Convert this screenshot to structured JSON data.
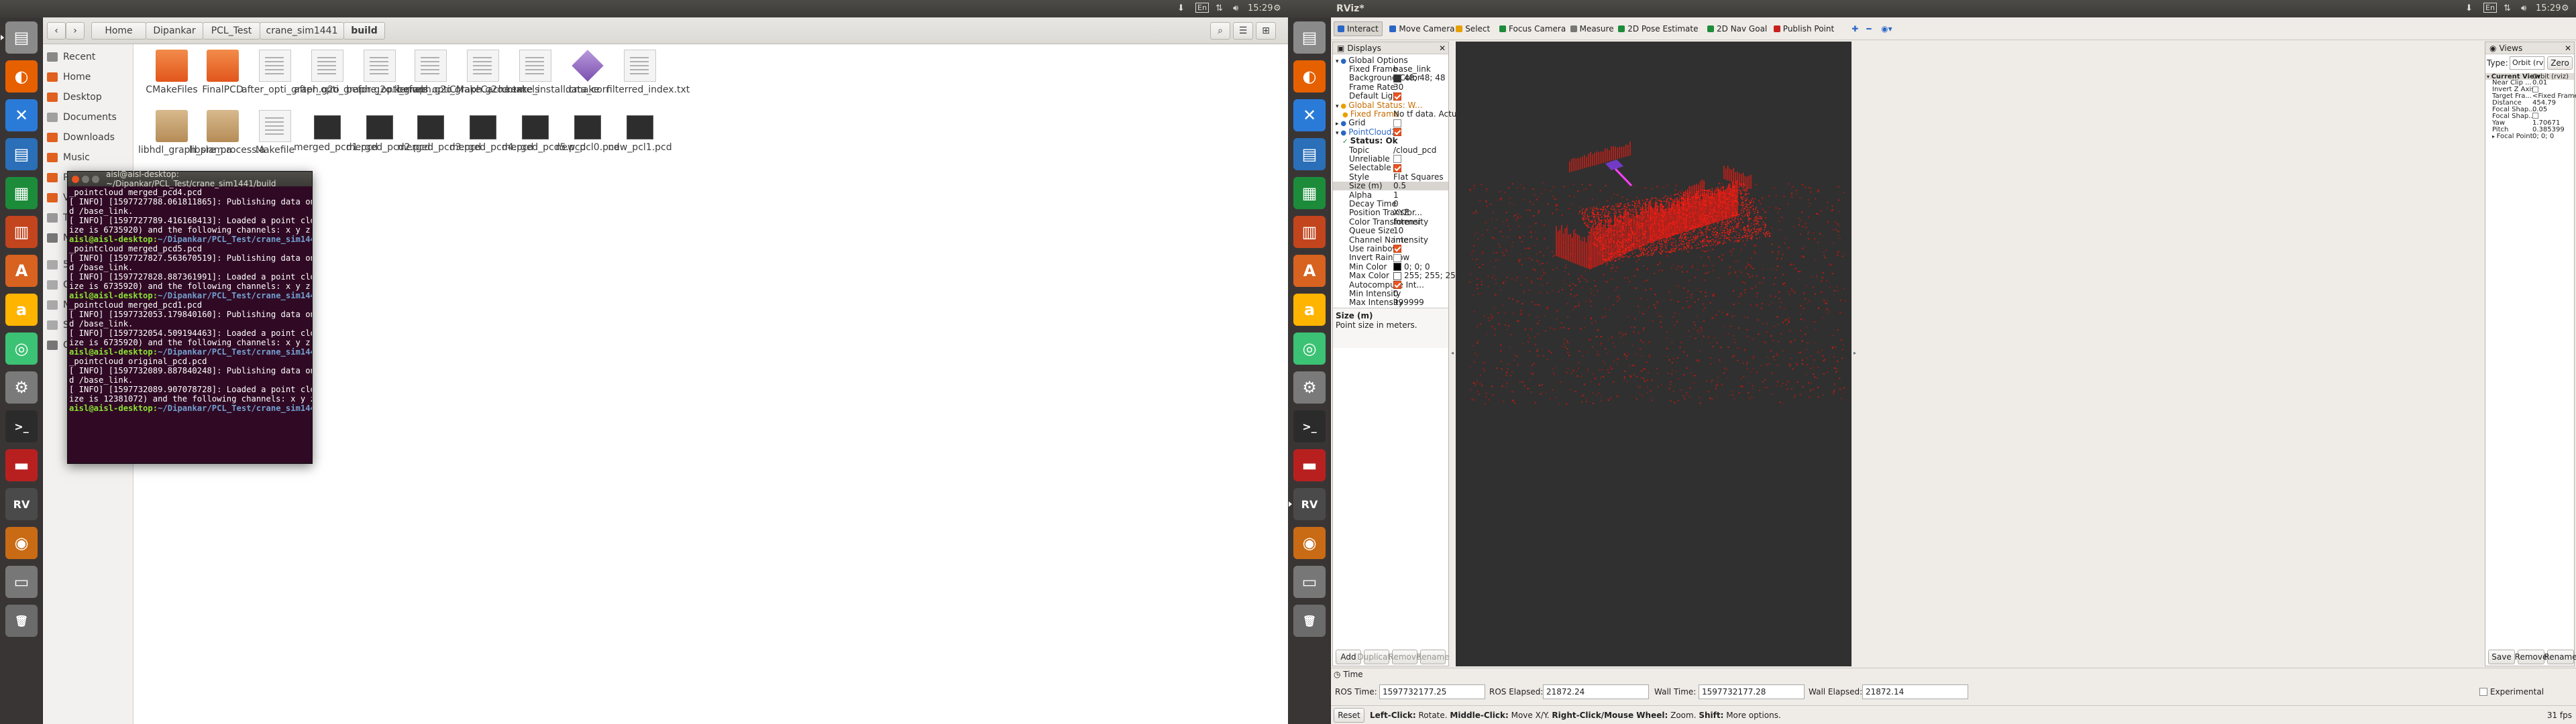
{
  "left": {
    "topbar": {
      "time": "15:29"
    },
    "launcher": [
      "Files",
      "Firefox",
      "VS Code",
      "Writer",
      "Calc",
      "Impress",
      "Software",
      "Amazon",
      "Atom",
      "Settings",
      "Terminal",
      "System Monitor",
      "RViz",
      "Photos",
      "Drive",
      "Trash"
    ],
    "files": {
      "breadcrumb": [
        "Home",
        "Dipankar",
        "PCL_Test",
        "crane_sim1441",
        "build"
      ],
      "sidebar": [
        "Recent",
        "Home",
        "Desktop",
        "Documents",
        "Downloads",
        "Music",
        "Pictures",
        "Videos",
        "Trash",
        "Network",
        "587 GB Volume",
        "Computer",
        "New Volume",
        "SAMSUNG Android",
        "Connect to Server"
      ],
      "items": [
        {
          "name": "CMakeFiles",
          "type": "folder"
        },
        {
          "name": "FinalPCD",
          "type": "folder"
        },
        {
          "name": "after_opti_graph.g2o",
          "type": "doc"
        },
        {
          "name": "after_opti_graph.g2o.kernels",
          "type": "doc"
        },
        {
          "name": "before_opti_graph.g2o",
          "type": "doc"
        },
        {
          "name": "before_opti_graph.g2o.kernels",
          "type": "doc"
        },
        {
          "name": "CMakeCache.txt",
          "type": "doc"
        },
        {
          "name": "cmake_install.cmake",
          "type": "doc"
        },
        {
          "name": "data_corr",
          "type": "dia"
        },
        {
          "name": "filterred_index.txt",
          "type": "doc"
        },
        {
          "name": "libhdl_graph_slam.a",
          "type": "arch"
        },
        {
          "name": "libpre_process.a",
          "type": "arch"
        },
        {
          "name": "Makefile",
          "type": "doc"
        },
        {
          "name": "merged_pcd1.pcd",
          "type": "pcd"
        },
        {
          "name": "merged_pcd2.pcd",
          "type": "pcd"
        },
        {
          "name": "merged_pcd3.pcd",
          "type": "pcd"
        },
        {
          "name": "merged_pcd4.pcd",
          "type": "pcd"
        },
        {
          "name": "merged_pcd5.pcd",
          "type": "pcd"
        },
        {
          "name": "new_pcl0.pcd",
          "type": "pcd"
        },
        {
          "name": "new_pcl1.pcd",
          "type": "pcd"
        }
      ]
    },
    "terminal": {
      "title": "aisl@aisl-desktop: ~/Dipankar/PCL_Test/crane_sim1441/build",
      "lines": [
        [
          "t",
          "_pointcloud merged_pcd4.pcd"
        ],
        [
          "t",
          "[ INFO] [1597727788.061811865]: Publishing data on topic /cloud_pcd with frame_i"
        ],
        [
          "t",
          "d /base_link."
        ],
        [
          "t",
          "[ INFO] [1597727789.416168413]: Loaded a point cloud with 420995 points (total s"
        ],
        [
          "t",
          "ize is 6735920) and the following channels: x y z intensity."
        ],
        [
          "p",
          "aisl@aisl-desktop",
          "~/Dipankar/PCL_Test/crane_sim1441/build",
          "$ rosrun pcl_ros pcd_to"
        ],
        [
          "t",
          "_pointcloud merged_pcd5.pcd"
        ],
        [
          "t",
          "[ INFO] [1597727827.563670519]: Publishing data on topic /cloud_pcd with frame_i"
        ],
        [
          "t",
          "d /base_link."
        ],
        [
          "t",
          "[ INFO] [1597727828.887361991]: Loaded a point cloud with 420995 points (total s"
        ],
        [
          "t",
          "ize is 6735920) and the following channels: x y z intensity."
        ],
        [
          "p",
          "aisl@aisl-desktop",
          "~/Dipankar/PCL_Test/crane_sim1441/build",
          "$ rosrun pcl_ros pcd_to"
        ],
        [
          "t",
          "_pointcloud merged_pcd1.pcd"
        ],
        [
          "t",
          "[ INFO] [1597732053.179840160]: Publishing data on topic /cloud_pcd with frame_i"
        ],
        [
          "t",
          "d /base_link."
        ],
        [
          "t",
          "[ INFO] [1597732054.509194463]: Loaded a point cloud with 420995 points (total s"
        ],
        [
          "t",
          "ize is 6735920) and the following channels: x y z intensity."
        ],
        [
          "p",
          "aisl@aisl-desktop",
          "~/Dipankar/PCL_Test/crane_sim1441/build",
          "$ rosrun pcl_ros pcd_to"
        ],
        [
          "t",
          "_pointcloud original_pcd.pcd"
        ],
        [
          "t",
          "[ INFO] [1597732089.887840248]: Publishing data on topic /cloud_pcd with frame_i"
        ],
        [
          "t",
          "d /base_link."
        ],
        [
          "t",
          "[ INFO] [1597732089.907078728]: Loaded a point cloud with 773817 points (total s"
        ],
        [
          "t",
          "ize is 12381072) and the following channels: x y z intensity."
        ],
        [
          "p",
          "aisl@aisl-desktop",
          "~/Dipankar/PCL_Test/crane_sim1441/build",
          "$ "
        ]
      ]
    }
  },
  "right": {
    "topbar": {
      "app": "RViz*",
      "time": "15:29"
    },
    "toolbar": [
      "Interact",
      "Move Camera",
      "Select",
      "Focus Camera",
      "Measure",
      "2D Pose Estimate",
      "2D Nav Goal",
      "Publish Point"
    ],
    "displays": {
      "title": "Displays",
      "rows": [
        {
          "k": "Global Options",
          "v": "",
          "lvl": 0,
          "h": true
        },
        {
          "k": "Fixed Frame",
          "v": "base_link",
          "lvl": 2
        },
        {
          "k": "Background Color",
          "v": "48; 48; 48",
          "lvl": 2,
          "sw": "#303030"
        },
        {
          "k": "Frame Rate",
          "v": "30",
          "lvl": 2
        },
        {
          "k": "Default Light",
          "v": "",
          "lvl": 2,
          "cb": true
        },
        {
          "k": "Global Status: W...",
          "v": "",
          "lvl": 0,
          "warn": true,
          "h": true
        },
        {
          "k": "Fixed Frame",
          "v": "No tf data.  Actual erro...",
          "lvl": 1,
          "warn": true
        },
        {
          "k": "Grid",
          "v": "",
          "lvl": 0,
          "h": true,
          "cb": false
        },
        {
          "k": "PointCloud2",
          "v": "",
          "lvl": 0,
          "h": true,
          "cb": true,
          "blue": true
        },
        {
          "k": "Status: Ok",
          "v": "",
          "lvl": 1,
          "ok": true
        },
        {
          "k": "Topic",
          "v": "/cloud_pcd",
          "lvl": 2
        },
        {
          "k": "Unreliable",
          "v": "",
          "lvl": 2,
          "cb": false
        },
        {
          "k": "Selectable",
          "v": "",
          "lvl": 2,
          "cb": true
        },
        {
          "k": "Style",
          "v": "Flat Squares",
          "lvl": 2
        },
        {
          "k": "Size (m)",
          "v": "0.5",
          "lvl": 2,
          "sel": true
        },
        {
          "k": "Alpha",
          "v": "1",
          "lvl": 2
        },
        {
          "k": "Decay Time",
          "v": "0",
          "lvl": 2
        },
        {
          "k": "Position Transfor...",
          "v": "XYZ",
          "lvl": 2
        },
        {
          "k": "Color Transformer",
          "v": "Intensity",
          "lvl": 2
        },
        {
          "k": "Queue Size",
          "v": "10",
          "lvl": 2
        },
        {
          "k": "Channel Name",
          "v": "intensity",
          "lvl": 2
        },
        {
          "k": "Use rainbow",
          "v": "",
          "lvl": 2,
          "cb": true
        },
        {
          "k": "Invert Rainbow",
          "v": "",
          "lvl": 2,
          "cb": false
        },
        {
          "k": "Min Color",
          "v": "0; 0; 0",
          "lvl": 2,
          "sw": "#000000"
        },
        {
          "k": "Max Color",
          "v": "255; 255; 255",
          "lvl": 2,
          "sw": "#ffffff"
        },
        {
          "k": "Autocompute Int...",
          "v": "",
          "lvl": 2,
          "cb": true
        },
        {
          "k": "Min Intensity",
          "v": "0",
          "lvl": 2
        },
        {
          "k": "Max Intensity",
          "v": "999999",
          "lvl": 2
        }
      ],
      "desc_title": "Size (m)",
      "desc": "Point size in meters.",
      "buttons": [
        "Add",
        "Duplicate",
        "Remove",
        "Rename"
      ]
    },
    "views": {
      "title": "Views",
      "type_label": "Type:",
      "type_value": "Orbit (rviz)",
      "zero": "Zero",
      "rows": [
        {
          "k": "Current View",
          "v": "Orbit (rviz)",
          "h": true
        },
        {
          "k": "Near Clip ...",
          "v": "0.01"
        },
        {
          "k": "Invert Z Axis",
          "v": "",
          "cb": false
        },
        {
          "k": "Target Fra...",
          "v": "<Fixed Frame>"
        },
        {
          "k": "Distance",
          "v": "454.79"
        },
        {
          "k": "Focal Shap...",
          "v": "0.05"
        },
        {
          "k": "Focal Shap...",
          "v": "",
          "cb": false
        },
        {
          "k": "Yaw",
          "v": "1.70671"
        },
        {
          "k": "Pitch",
          "v": "0.385399"
        },
        {
          "k": "Focal Point",
          "v": "0; 0; 0",
          "exp": true
        }
      ],
      "buttons": [
        "Save",
        "Remove",
        "Rename"
      ]
    },
    "time": {
      "title": "Time",
      "ros_time_label": "ROS Time:",
      "ros_time": "1597732177.25",
      "ros_elapsed_label": "ROS Elapsed:",
      "ros_elapsed": "21872.24",
      "wall_time_label": "Wall Time:",
      "wall_time": "1597732177.28",
      "wall_elapsed_label": "Wall Elapsed:",
      "wall_elapsed": "21872.14",
      "experimental": "Experimental"
    },
    "status": {
      "reset": "Reset",
      "hint_b1": "Left-Click:",
      "hint_t1": " Rotate. ",
      "hint_b2": "Middle-Click:",
      "hint_t2": " Move X/Y. ",
      "hint_b3": "Right-Click/Mouse Wheel:",
      "hint_t3": " Zoom. ",
      "hint_b4": "Shift:",
      "hint_t4": " More options.",
      "fps": "31 fps"
    }
  }
}
